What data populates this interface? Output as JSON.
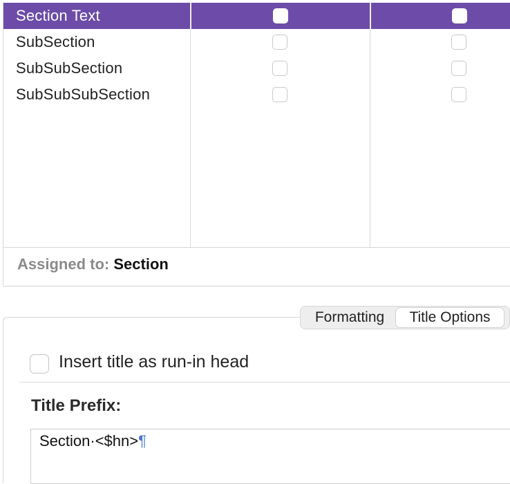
{
  "table": {
    "rows": [
      {
        "label": "Section Text",
        "selected": true
      },
      {
        "label": "SubSection",
        "selected": false
      },
      {
        "label": "SubSubSection",
        "selected": false
      },
      {
        "label": "SubSubSubSection",
        "selected": false
      }
    ],
    "assigned_label": "Assigned to:",
    "assigned_value": "Section"
  },
  "tabs": [
    {
      "label": "Formatting",
      "active": false
    },
    {
      "label": "Title Options",
      "active": true
    }
  ],
  "options": {
    "runin_label": "Insert title as run-in head",
    "runin_checked": false,
    "prefix_title": "Title Prefix:",
    "prefix_value": "Section·<$hn>",
    "pilcrow": "¶"
  },
  "colors": {
    "selection": "#6c4ca8",
    "pilcrow": "#4a78c8"
  }
}
